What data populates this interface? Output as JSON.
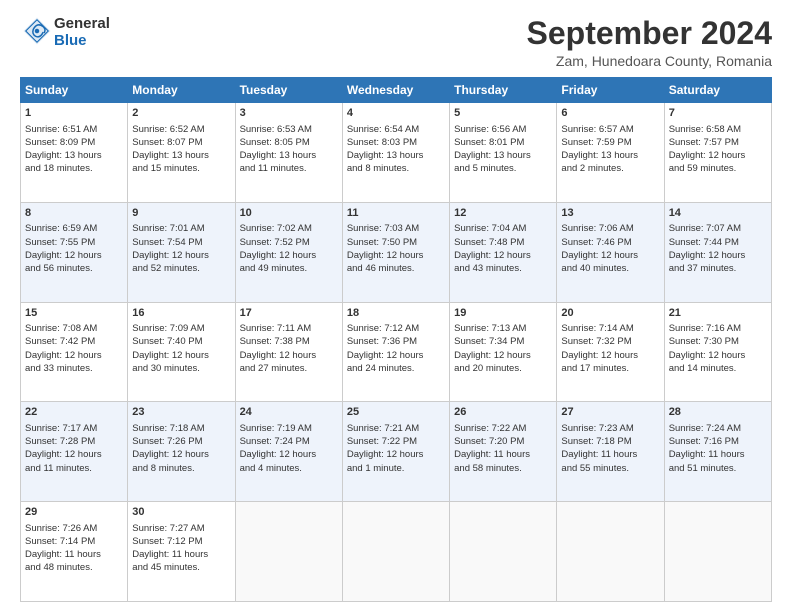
{
  "header": {
    "logo_general": "General",
    "logo_blue": "Blue",
    "month_title": "September 2024",
    "location": "Zam, Hunedoara County, Romania"
  },
  "days_of_week": [
    "Sunday",
    "Monday",
    "Tuesday",
    "Wednesday",
    "Thursday",
    "Friday",
    "Saturday"
  ],
  "weeks": [
    [
      {
        "day": 1,
        "info": [
          "Sunrise: 6:51 AM",
          "Sunset: 8:09 PM",
          "Daylight: 13 hours",
          "and 18 minutes."
        ]
      },
      {
        "day": 2,
        "info": [
          "Sunrise: 6:52 AM",
          "Sunset: 8:07 PM",
          "Daylight: 13 hours",
          "and 15 minutes."
        ]
      },
      {
        "day": 3,
        "info": [
          "Sunrise: 6:53 AM",
          "Sunset: 8:05 PM",
          "Daylight: 13 hours",
          "and 11 minutes."
        ]
      },
      {
        "day": 4,
        "info": [
          "Sunrise: 6:54 AM",
          "Sunset: 8:03 PM",
          "Daylight: 13 hours",
          "and 8 minutes."
        ]
      },
      {
        "day": 5,
        "info": [
          "Sunrise: 6:56 AM",
          "Sunset: 8:01 PM",
          "Daylight: 13 hours",
          "and 5 minutes."
        ]
      },
      {
        "day": 6,
        "info": [
          "Sunrise: 6:57 AM",
          "Sunset: 7:59 PM",
          "Daylight: 13 hours",
          "and 2 minutes."
        ]
      },
      {
        "day": 7,
        "info": [
          "Sunrise: 6:58 AM",
          "Sunset: 7:57 PM",
          "Daylight: 12 hours",
          "and 59 minutes."
        ]
      }
    ],
    [
      {
        "day": 8,
        "info": [
          "Sunrise: 6:59 AM",
          "Sunset: 7:55 PM",
          "Daylight: 12 hours",
          "and 56 minutes."
        ]
      },
      {
        "day": 9,
        "info": [
          "Sunrise: 7:01 AM",
          "Sunset: 7:54 PM",
          "Daylight: 12 hours",
          "and 52 minutes."
        ]
      },
      {
        "day": 10,
        "info": [
          "Sunrise: 7:02 AM",
          "Sunset: 7:52 PM",
          "Daylight: 12 hours",
          "and 49 minutes."
        ]
      },
      {
        "day": 11,
        "info": [
          "Sunrise: 7:03 AM",
          "Sunset: 7:50 PM",
          "Daylight: 12 hours",
          "and 46 minutes."
        ]
      },
      {
        "day": 12,
        "info": [
          "Sunrise: 7:04 AM",
          "Sunset: 7:48 PM",
          "Daylight: 12 hours",
          "and 43 minutes."
        ]
      },
      {
        "day": 13,
        "info": [
          "Sunrise: 7:06 AM",
          "Sunset: 7:46 PM",
          "Daylight: 12 hours",
          "and 40 minutes."
        ]
      },
      {
        "day": 14,
        "info": [
          "Sunrise: 7:07 AM",
          "Sunset: 7:44 PM",
          "Daylight: 12 hours",
          "and 37 minutes."
        ]
      }
    ],
    [
      {
        "day": 15,
        "info": [
          "Sunrise: 7:08 AM",
          "Sunset: 7:42 PM",
          "Daylight: 12 hours",
          "and 33 minutes."
        ]
      },
      {
        "day": 16,
        "info": [
          "Sunrise: 7:09 AM",
          "Sunset: 7:40 PM",
          "Daylight: 12 hours",
          "and 30 minutes."
        ]
      },
      {
        "day": 17,
        "info": [
          "Sunrise: 7:11 AM",
          "Sunset: 7:38 PM",
          "Daylight: 12 hours",
          "and 27 minutes."
        ]
      },
      {
        "day": 18,
        "info": [
          "Sunrise: 7:12 AM",
          "Sunset: 7:36 PM",
          "Daylight: 12 hours",
          "and 24 minutes."
        ]
      },
      {
        "day": 19,
        "info": [
          "Sunrise: 7:13 AM",
          "Sunset: 7:34 PM",
          "Daylight: 12 hours",
          "and 20 minutes."
        ]
      },
      {
        "day": 20,
        "info": [
          "Sunrise: 7:14 AM",
          "Sunset: 7:32 PM",
          "Daylight: 12 hours",
          "and 17 minutes."
        ]
      },
      {
        "day": 21,
        "info": [
          "Sunrise: 7:16 AM",
          "Sunset: 7:30 PM",
          "Daylight: 12 hours",
          "and 14 minutes."
        ]
      }
    ],
    [
      {
        "day": 22,
        "info": [
          "Sunrise: 7:17 AM",
          "Sunset: 7:28 PM",
          "Daylight: 12 hours",
          "and 11 minutes."
        ]
      },
      {
        "day": 23,
        "info": [
          "Sunrise: 7:18 AM",
          "Sunset: 7:26 PM",
          "Daylight: 12 hours",
          "and 8 minutes."
        ]
      },
      {
        "day": 24,
        "info": [
          "Sunrise: 7:19 AM",
          "Sunset: 7:24 PM",
          "Daylight: 12 hours",
          "and 4 minutes."
        ]
      },
      {
        "day": 25,
        "info": [
          "Sunrise: 7:21 AM",
          "Sunset: 7:22 PM",
          "Daylight: 12 hours",
          "and 1 minute."
        ]
      },
      {
        "day": 26,
        "info": [
          "Sunrise: 7:22 AM",
          "Sunset: 7:20 PM",
          "Daylight: 11 hours",
          "and 58 minutes."
        ]
      },
      {
        "day": 27,
        "info": [
          "Sunrise: 7:23 AM",
          "Sunset: 7:18 PM",
          "Daylight: 11 hours",
          "and 55 minutes."
        ]
      },
      {
        "day": 28,
        "info": [
          "Sunrise: 7:24 AM",
          "Sunset: 7:16 PM",
          "Daylight: 11 hours",
          "and 51 minutes."
        ]
      }
    ],
    [
      {
        "day": 29,
        "info": [
          "Sunrise: 7:26 AM",
          "Sunset: 7:14 PM",
          "Daylight: 11 hours",
          "and 48 minutes."
        ]
      },
      {
        "day": 30,
        "info": [
          "Sunrise: 7:27 AM",
          "Sunset: 7:12 PM",
          "Daylight: 11 hours",
          "and 45 minutes."
        ]
      },
      null,
      null,
      null,
      null,
      null
    ]
  ]
}
